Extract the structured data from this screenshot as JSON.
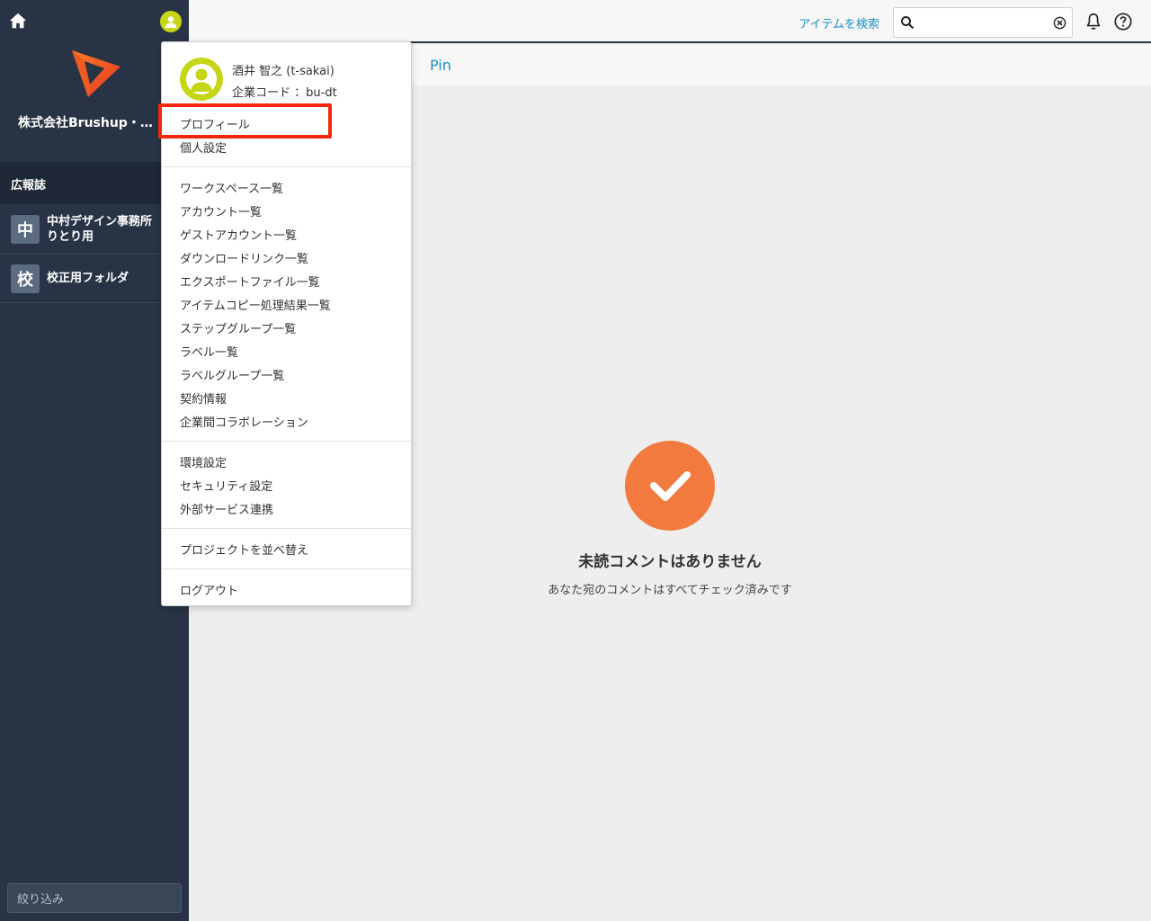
{
  "colors": {
    "sidebar_bg": "#283445",
    "accent_blue": "#1c92c9",
    "check_orange": "#f27a3f",
    "avatar_green": "#c6d515",
    "highlight_red": "#f2270c"
  },
  "sidebar": {
    "company_name": "株式会社Brushup・…",
    "section_title": "広報誌",
    "folders": [
      {
        "badge": "中",
        "label": "中村デザイン事務所\nりとり用"
      },
      {
        "badge": "校",
        "label": "校正用フォルダ"
      }
    ],
    "filter_placeholder": "絞り込み"
  },
  "topbar": {
    "search_link": "アイテムを検索",
    "search_value": ""
  },
  "tabs": {
    "pin_label": "Pin"
  },
  "empty_state": {
    "title": "未読コメントはありません",
    "subtitle": "あなた宛のコメントはすべてチェック済みです"
  },
  "user_menu": {
    "user_name": "酒井 智之 (t-sakai)",
    "company_code": "企業コード ：bu-dt",
    "profile_items": [
      "プロフィール",
      "個人設定"
    ],
    "list_items": [
      "ワークスペース一覧",
      "アカウント一覧",
      "ゲストアカウント一覧",
      "ダウンロードリンク一覧",
      "エクスポートファイル一覧",
      "アイテムコピー処理結果一覧",
      "ステップグループ一覧",
      "ラベル一覧",
      "ラベルグループ一覧",
      "契約情報",
      "企業間コラボレーション"
    ],
    "settings_items": [
      "環境設定",
      "セキュリティ設定",
      "外部サービス連携"
    ],
    "sort_label": "プロジェクトを並べ替え",
    "logout_label": "ログアウト"
  }
}
